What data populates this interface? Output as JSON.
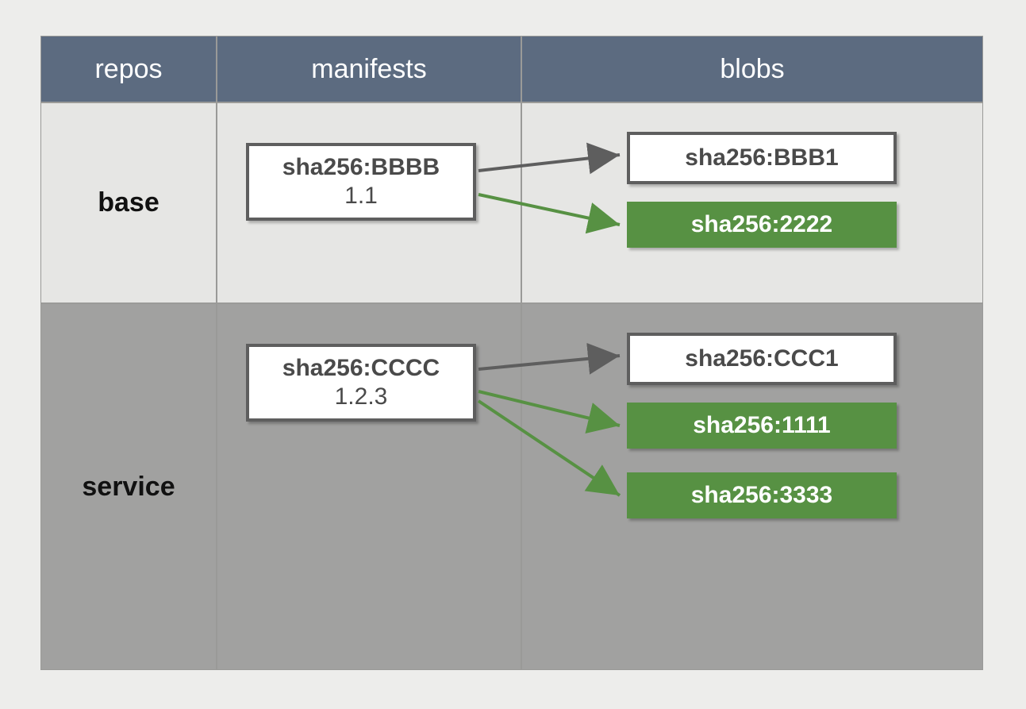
{
  "headers": {
    "repos": "repos",
    "manifests": "manifests",
    "blobs": "blobs"
  },
  "rows": [
    {
      "repo": "base",
      "manifest": {
        "sha": "sha256:BBBB",
        "tag": "1.1"
      },
      "blobs": [
        {
          "sha": "sha256:BBB1",
          "style": "white"
        },
        {
          "sha": "sha256:2222",
          "style": "green"
        }
      ]
    },
    {
      "repo": "service",
      "manifest": {
        "sha": "sha256:CCCC",
        "tag": "1.2.3"
      },
      "blobs": [
        {
          "sha": "sha256:CCC1",
          "style": "white"
        },
        {
          "sha": "sha256:1111",
          "style": "green"
        },
        {
          "sha": "sha256:3333",
          "style": "green"
        }
      ]
    }
  ],
  "colors": {
    "header_bg": "#5c6b80",
    "row1_bg": "#e6e6e4",
    "row2_bg": "#a1a1a0",
    "border": "#9a9a98",
    "box_border": "#5e5e5e",
    "green": "#579143",
    "arrow_gray": "#5e5e5e",
    "arrow_green": "#579143"
  }
}
